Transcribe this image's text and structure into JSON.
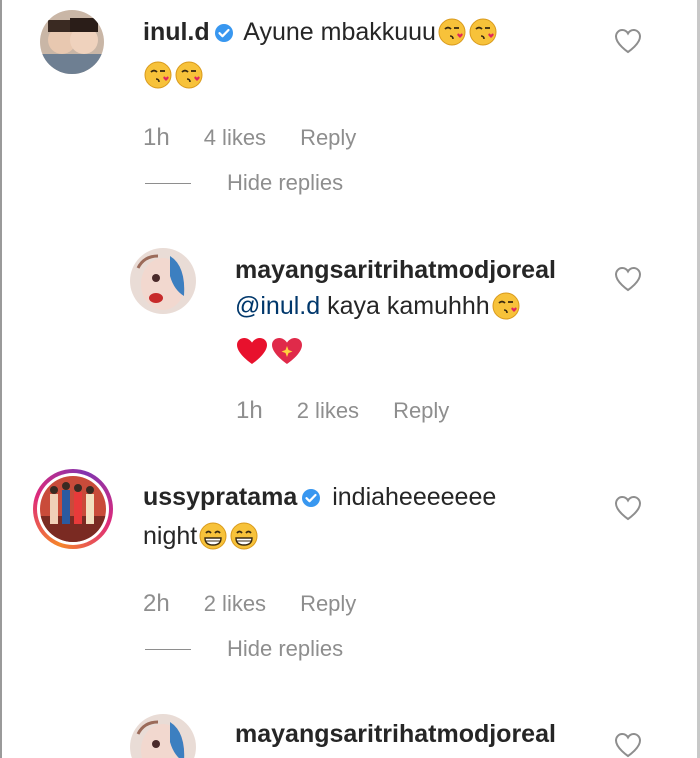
{
  "comments": [
    {
      "username": "inul.d",
      "verified": true,
      "text_line1": "Ayune mbakkuuu",
      "time": "1h",
      "likes": "4 likes",
      "reply": "Reply",
      "hide_replies": "Hide replies"
    },
    {
      "username": "mayangsaritrihatmodjoreal",
      "mention": "@inul.d",
      "text": " kaya kamuhhh",
      "time": "1h",
      "likes": "2 likes",
      "reply": "Reply"
    },
    {
      "username": "ussypratama",
      "verified": true,
      "text_line1": "indiaheeeeeee",
      "text_line2": "night",
      "time": "2h",
      "likes": "2 likes",
      "reply": "Reply",
      "hide_replies": "Hide replies"
    },
    {
      "username": "mayangsaritrihatmodjoreal"
    }
  ],
  "icons": {
    "like": "heart-outline-icon",
    "verified": "verified-badge-icon",
    "kiss_emoji": "face-blowing-kiss-emoji",
    "grin_emoji": "grinning-face-emoji",
    "heart_emoji": "red-heart-emoji",
    "sparkle_heart_emoji": "sparkling-heart-emoji"
  },
  "colors": {
    "text": "#262626",
    "secondary": "#8e8e8e",
    "mention": "#00376b",
    "verified": "#3897f0"
  }
}
